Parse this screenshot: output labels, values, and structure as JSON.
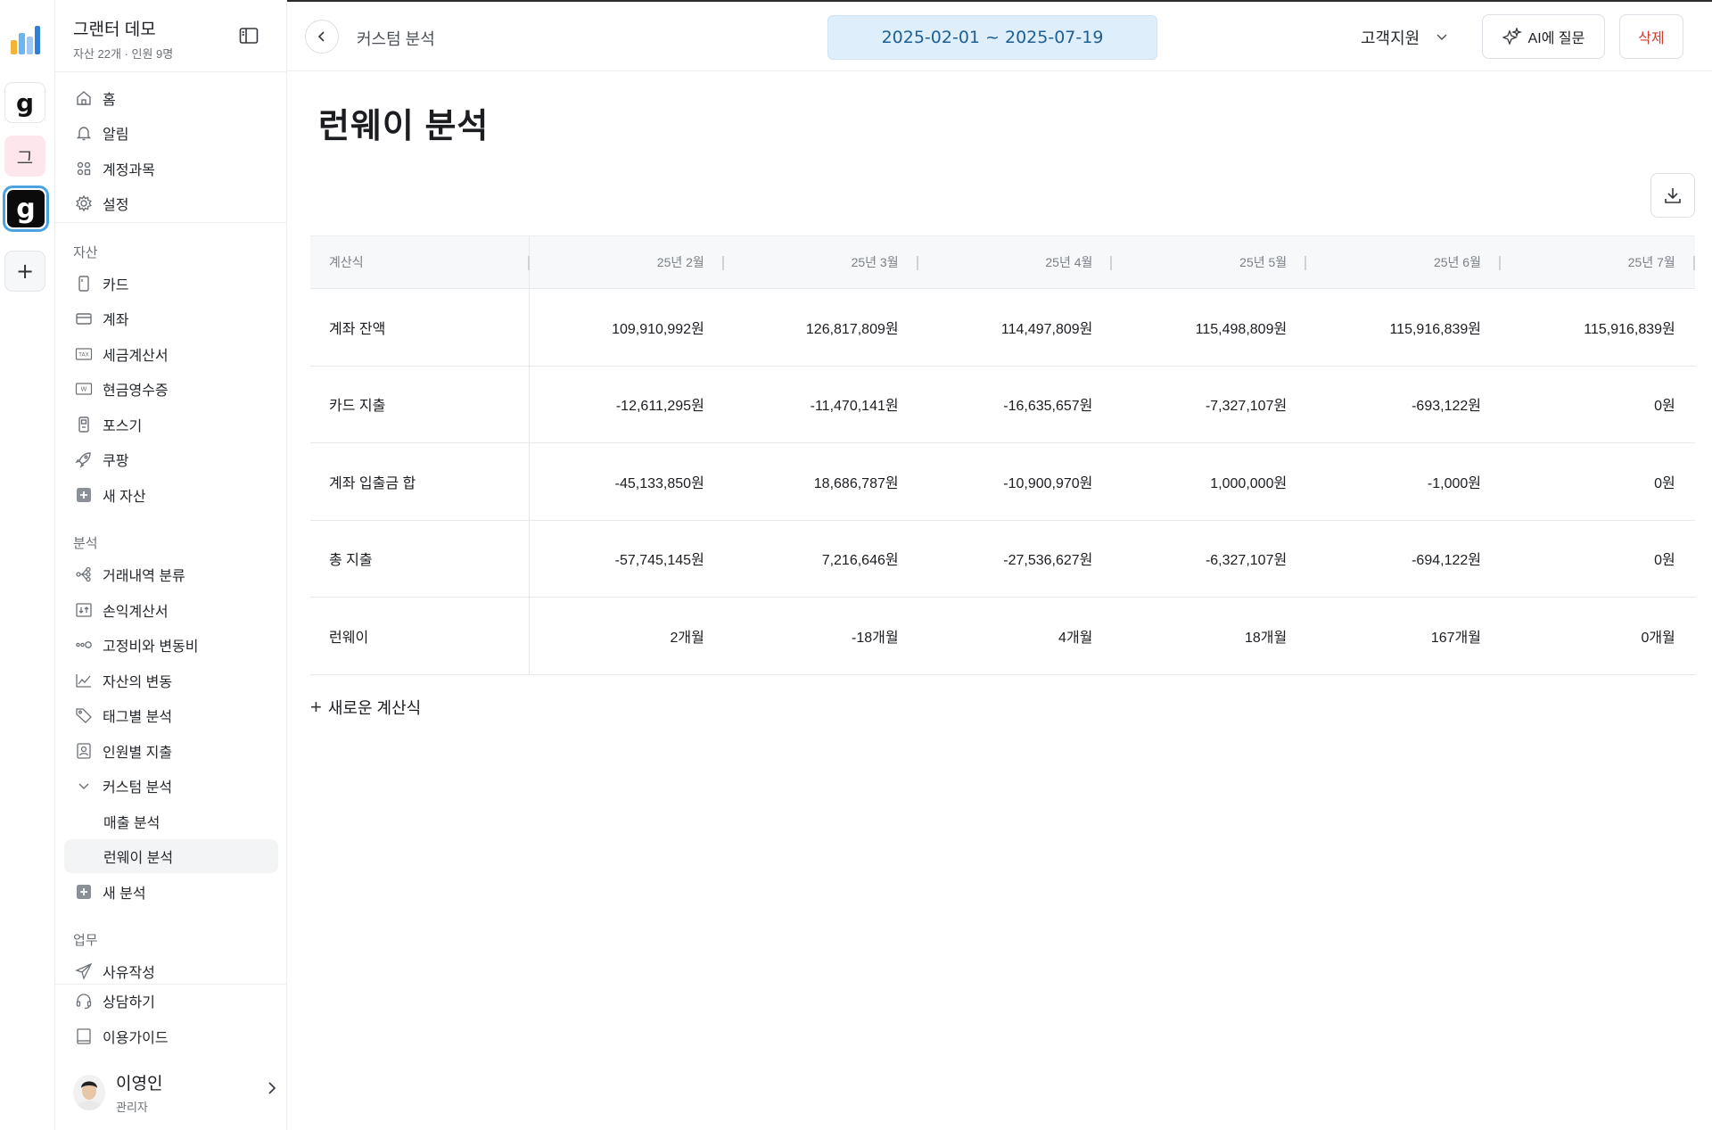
{
  "rail": {
    "workspaces": [
      {
        "icon": "bar-chart-logo-icon"
      },
      {
        "label": "g"
      },
      {
        "label": "그"
      },
      {
        "label": "g"
      }
    ],
    "add_label": "+"
  },
  "sidebar": {
    "org_name": "그랜터 데모",
    "org_sub": "자산 22개 · 인원 9명",
    "top_items": [
      {
        "label": "홈",
        "icon": "home-icon"
      },
      {
        "label": "알림",
        "icon": "bell-icon"
      },
      {
        "label": "계정과목",
        "icon": "grid-icon"
      },
      {
        "label": "설정",
        "icon": "gear-icon"
      }
    ],
    "assets_section": "자산",
    "asset_items": [
      {
        "label": "카드",
        "icon": "card-icon"
      },
      {
        "label": "계좌",
        "icon": "account-icon"
      },
      {
        "label": "세금계산서",
        "icon": "tax-invoice-icon"
      },
      {
        "label": "현금영수증",
        "icon": "cash-receipt-icon"
      },
      {
        "label": "포스기",
        "icon": "pos-icon"
      },
      {
        "label": "쿠팡",
        "icon": "rocket-icon"
      },
      {
        "label": "새 자산",
        "icon": "plus-square-icon"
      }
    ],
    "analysis_section": "분석",
    "analysis_items": [
      {
        "label": "거래내역 분류",
        "icon": "classify-icon"
      },
      {
        "label": "손익계산서",
        "icon": "pnl-icon"
      },
      {
        "label": "고정비와 변동비",
        "icon": "fixed-variable-icon"
      },
      {
        "label": "자산의 변동",
        "icon": "trend-icon"
      },
      {
        "label": "태그별 분석",
        "icon": "tag-icon"
      },
      {
        "label": "인원별 지출",
        "icon": "person-icon"
      },
      {
        "label": "커스텀 분석",
        "icon": "chevron-down-icon"
      }
    ],
    "custom_sub_items": [
      {
        "label": "매출 분석",
        "active": false
      },
      {
        "label": "런웨이 분석",
        "active": true
      }
    ],
    "new_analysis": "새 분석",
    "work_section": "업무",
    "work_items": [
      {
        "label": "사유작성",
        "icon": "send-icon"
      }
    ],
    "footer_items": [
      {
        "label": "상담하기",
        "icon": "headset-icon"
      },
      {
        "label": "이용가이드",
        "icon": "book-icon"
      }
    ],
    "user": {
      "name": "이영인",
      "role": "관리자"
    }
  },
  "topbar": {
    "breadcrumb": "커스텀 분석",
    "date_range": "2025-02-01 ~ 2025-07-19",
    "department": "고객지원",
    "ai_button": "AI에 질문",
    "delete_button": "삭제"
  },
  "main": {
    "title": "런웨이 분석",
    "new_formula": "새로운 계산식",
    "table": {
      "label_header": "계산식",
      "columns": [
        "25년 2월",
        "25년 3월",
        "25년 4월",
        "25년 5월",
        "25년 6월",
        "25년 7월"
      ],
      "rows": [
        {
          "label": "계좌 잔액",
          "values": [
            "109,910,992원",
            "126,817,809원",
            "114,497,809원",
            "115,498,809원",
            "115,916,839원",
            "115,916,839원"
          ]
        },
        {
          "label": "카드 지출",
          "values": [
            "-12,611,295원",
            "-11,470,141원",
            "-16,635,657원",
            "-7,327,107원",
            "-693,122원",
            "0원"
          ]
        },
        {
          "label": "계좌 입출금 합",
          "values": [
            "-45,133,850원",
            "18,686,787원",
            "-10,900,970원",
            "1,000,000원",
            "-1,000원",
            "0원"
          ]
        },
        {
          "label": "총 지출",
          "values": [
            "-57,745,145원",
            "7,216,646원",
            "-27,536,627원",
            "-6,327,107원",
            "-694,122원",
            "0원"
          ]
        },
        {
          "label": "런웨이",
          "values": [
            "2개월",
            "-18개월",
            "4개월",
            "18개월",
            "167개월",
            "0개월"
          ]
        }
      ]
    }
  }
}
